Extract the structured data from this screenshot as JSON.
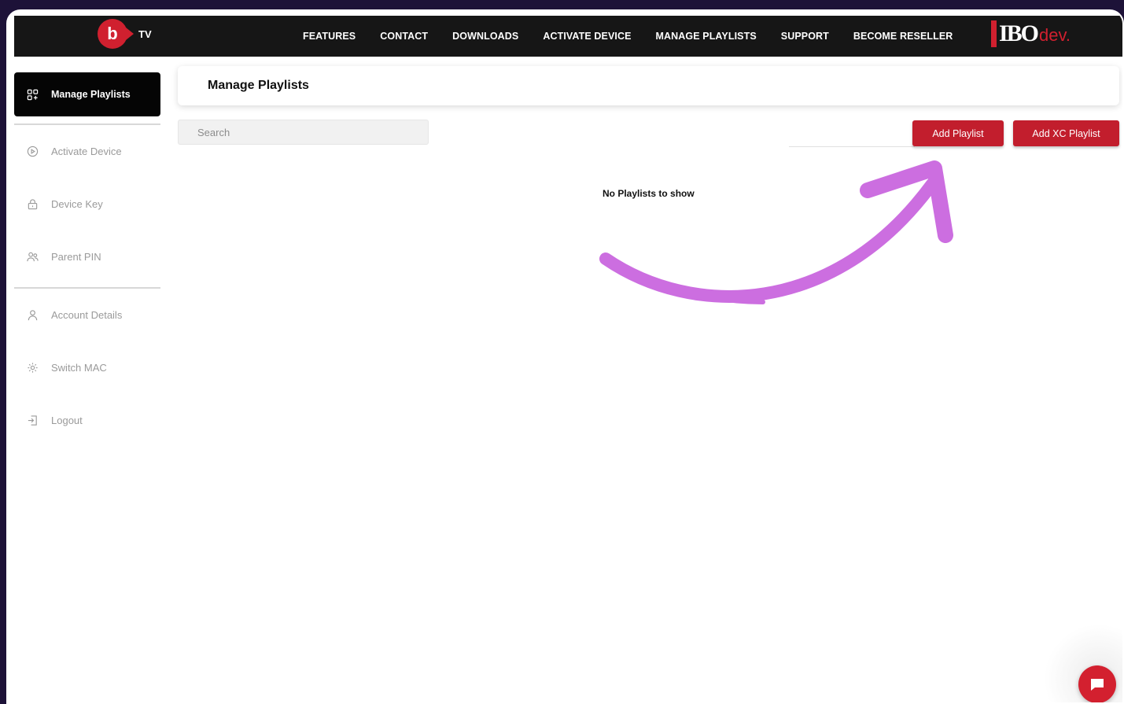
{
  "topbar": {
    "logo_text": "TV",
    "nav": [
      "FEATURES",
      "CONTACT",
      "DOWNLOADS",
      "ACTIVATE DEVICE",
      "MANAGE PLAYLISTS",
      "SUPPORT",
      "BECOME RESELLER"
    ],
    "brand_mark": "IBO",
    "brand_suffix": "dev."
  },
  "sidebar": {
    "active": {
      "label": "Manage Playlists",
      "icon": "grid-plus-icon"
    },
    "items": [
      {
        "label": "Activate Device",
        "icon": "play-circle-icon"
      },
      {
        "label": "Device Key",
        "icon": "lock-icon"
      },
      {
        "label": "Parent PIN",
        "icon": "users-icon"
      }
    ],
    "items2": [
      {
        "label": "Account Details",
        "icon": "user-icon"
      },
      {
        "label": "Switch MAC",
        "icon": "gear-icon"
      },
      {
        "label": "Logout",
        "icon": "logout-icon"
      }
    ]
  },
  "main": {
    "title": "Manage Playlists",
    "search_placeholder": "Search",
    "add_playlist": "Add Playlist",
    "add_xc_playlist": "Add XC Playlist",
    "empty_message": "No Playlists to show"
  },
  "colors": {
    "accent": "#c21e2d",
    "topbar": "#161616",
    "arrow": "#cc6ee0",
    "background": "#1d1238"
  }
}
